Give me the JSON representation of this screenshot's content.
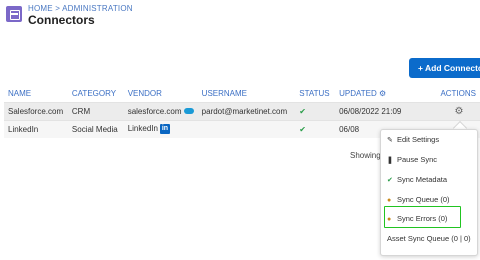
{
  "header": {
    "breadcrumb": "HOME > ADMINISTRATION",
    "title": "Connectors",
    "app_icon": "connectors-icon"
  },
  "toolbar": {
    "add_button_label": "+ Add Connecto"
  },
  "table": {
    "columns": [
      "NAME",
      "CATEGORY",
      "VENDOR",
      "USERNAME",
      "STATUS",
      "UPDATED",
      "ACTIONS"
    ],
    "updated_sort_icon": "sort-indicator-icon",
    "rows": [
      {
        "name": "Salesforce.com",
        "category": "CRM",
        "vendor": "salesforce.com",
        "vendor_icon": "salesforce-cloud-icon",
        "username": "pardot@marketinet.com",
        "status_icon": "check-icon",
        "updated": "06/08/2022 21:09",
        "actions_icon": "gear-icon"
      },
      {
        "name": "LinkedIn",
        "category": "Social Media",
        "vendor": "LinkedIn",
        "vendor_icon": "linkedin-icon",
        "username": "",
        "status_icon": "check-icon",
        "updated": "06/08",
        "actions_icon": ""
      }
    ]
  },
  "footer": {
    "showing": "Showing"
  },
  "actions_menu": {
    "items": [
      {
        "label": "Edit Settings",
        "icon": "edit-icon"
      },
      {
        "label": "Pause Sync",
        "icon": "pause-icon"
      },
      {
        "label": "Sync Metadata",
        "icon": "check-icon"
      },
      {
        "label": "Sync Queue (0)",
        "icon": "users-icon"
      },
      {
        "label": "Sync Errors (0)",
        "icon": "users-icon"
      },
      {
        "label": "Asset Sync Queue (0 | 0)",
        "icon": ""
      }
    ],
    "highlighted_item": "Sync Errors (0)",
    "highlight_color": "#21c421"
  },
  "colors": {
    "link": "#3b6fc4",
    "primary_button": "#0b6bcb",
    "status_ok": "#2a9d49"
  }
}
